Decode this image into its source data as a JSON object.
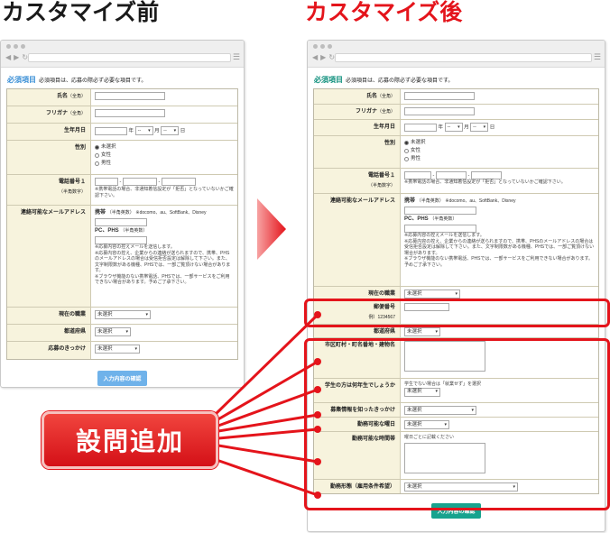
{
  "headings": {
    "before": "カスタマイズ前",
    "after": "カスタマイズ後"
  },
  "badge": "設問追加",
  "form": {
    "req_label": "必須項目",
    "req_note": "必須項目は、応募の際必ず必要な項目です。",
    "name_label": "氏名",
    "fullwidth_note": "（全角）",
    "kana_label": "フリガナ",
    "birth_label": "生年月日",
    "year": "年",
    "month": "月",
    "day": "日",
    "dash_opt": "--",
    "gender_label": "性別",
    "gender_options": [
      "未選択",
      "女性",
      "男性"
    ],
    "phone_label": "電話番号１",
    "halfwidth_note": "（半角数字）",
    "hyphen": "-",
    "phone_note": "※携帯電話の場合、非通知着信設定が「拒否」となっていないかご確認下さい。",
    "mail_label": "連絡可能なメールアドレス",
    "mobile_head": "携帯",
    "mobile_sub": "（半角英数）",
    "carriers": "※docomo、au、SoftBank、Disney",
    "pc_head": "PC、PHS",
    "pc_sub": "（半角英数）",
    "mail_notes_before": [
      "※応募内容の控えメールを送信します。",
      "※応募内容の控え、企業からの連絡が送られますので、携帯、PHSのメールアドレスの場合は受信拒否設定は解除して下さい。また、文字制限数がある機種、PHSでは、一部ご覧頂けない場合があります。",
      "※ブラウザ機能のない携帯電話、PHSでは、一部サービスをご利用できない場合があります。予めご了承下さい。"
    ],
    "mail_notes_after": [
      "※応募内容の控えメールを送信します。",
      "※応募内容の控え、企業からの連絡が送られますので、携帯、PHSのメールアドレスの場合は受信拒否設定は解除して下さい。また、文字制限数がある機種、PHSでは、一部ご覧頂けない場合があります。",
      "※ブラウザ機能のない携帯電話、PHSでは、一部サービスをご利用できない場合があります。予めご了承下さい。"
    ],
    "job_label": "現在の職業",
    "unselected": "未選択",
    "pref_label": "都道府県",
    "trigger_label": "応募のきっかけ",
    "submit": "入力内容の確認",
    "zip_label": "郵便番号",
    "zip_example": "例）1234567",
    "city_label": "市区町村・町名番地・建物名",
    "student_label": "学生の方は何年生でしょうか",
    "student_note": "学生でない場合は「就業せず」を選択",
    "source_label": "募集情報を知ったきっかけ",
    "days_label": "勤務可能な曜日",
    "hours_label": "勤務可能な時間帯",
    "hours_note": "曜日ごとに記載ください",
    "employ_label": "勤務形態（雇用条件希望）"
  },
  "colors": {
    "accent_red": "#e4141b",
    "submit_before": "#6fb2ea",
    "submit_after": "#17a38e",
    "required_before": "#3a8fd6",
    "required_after": "#0e8f7c"
  }
}
